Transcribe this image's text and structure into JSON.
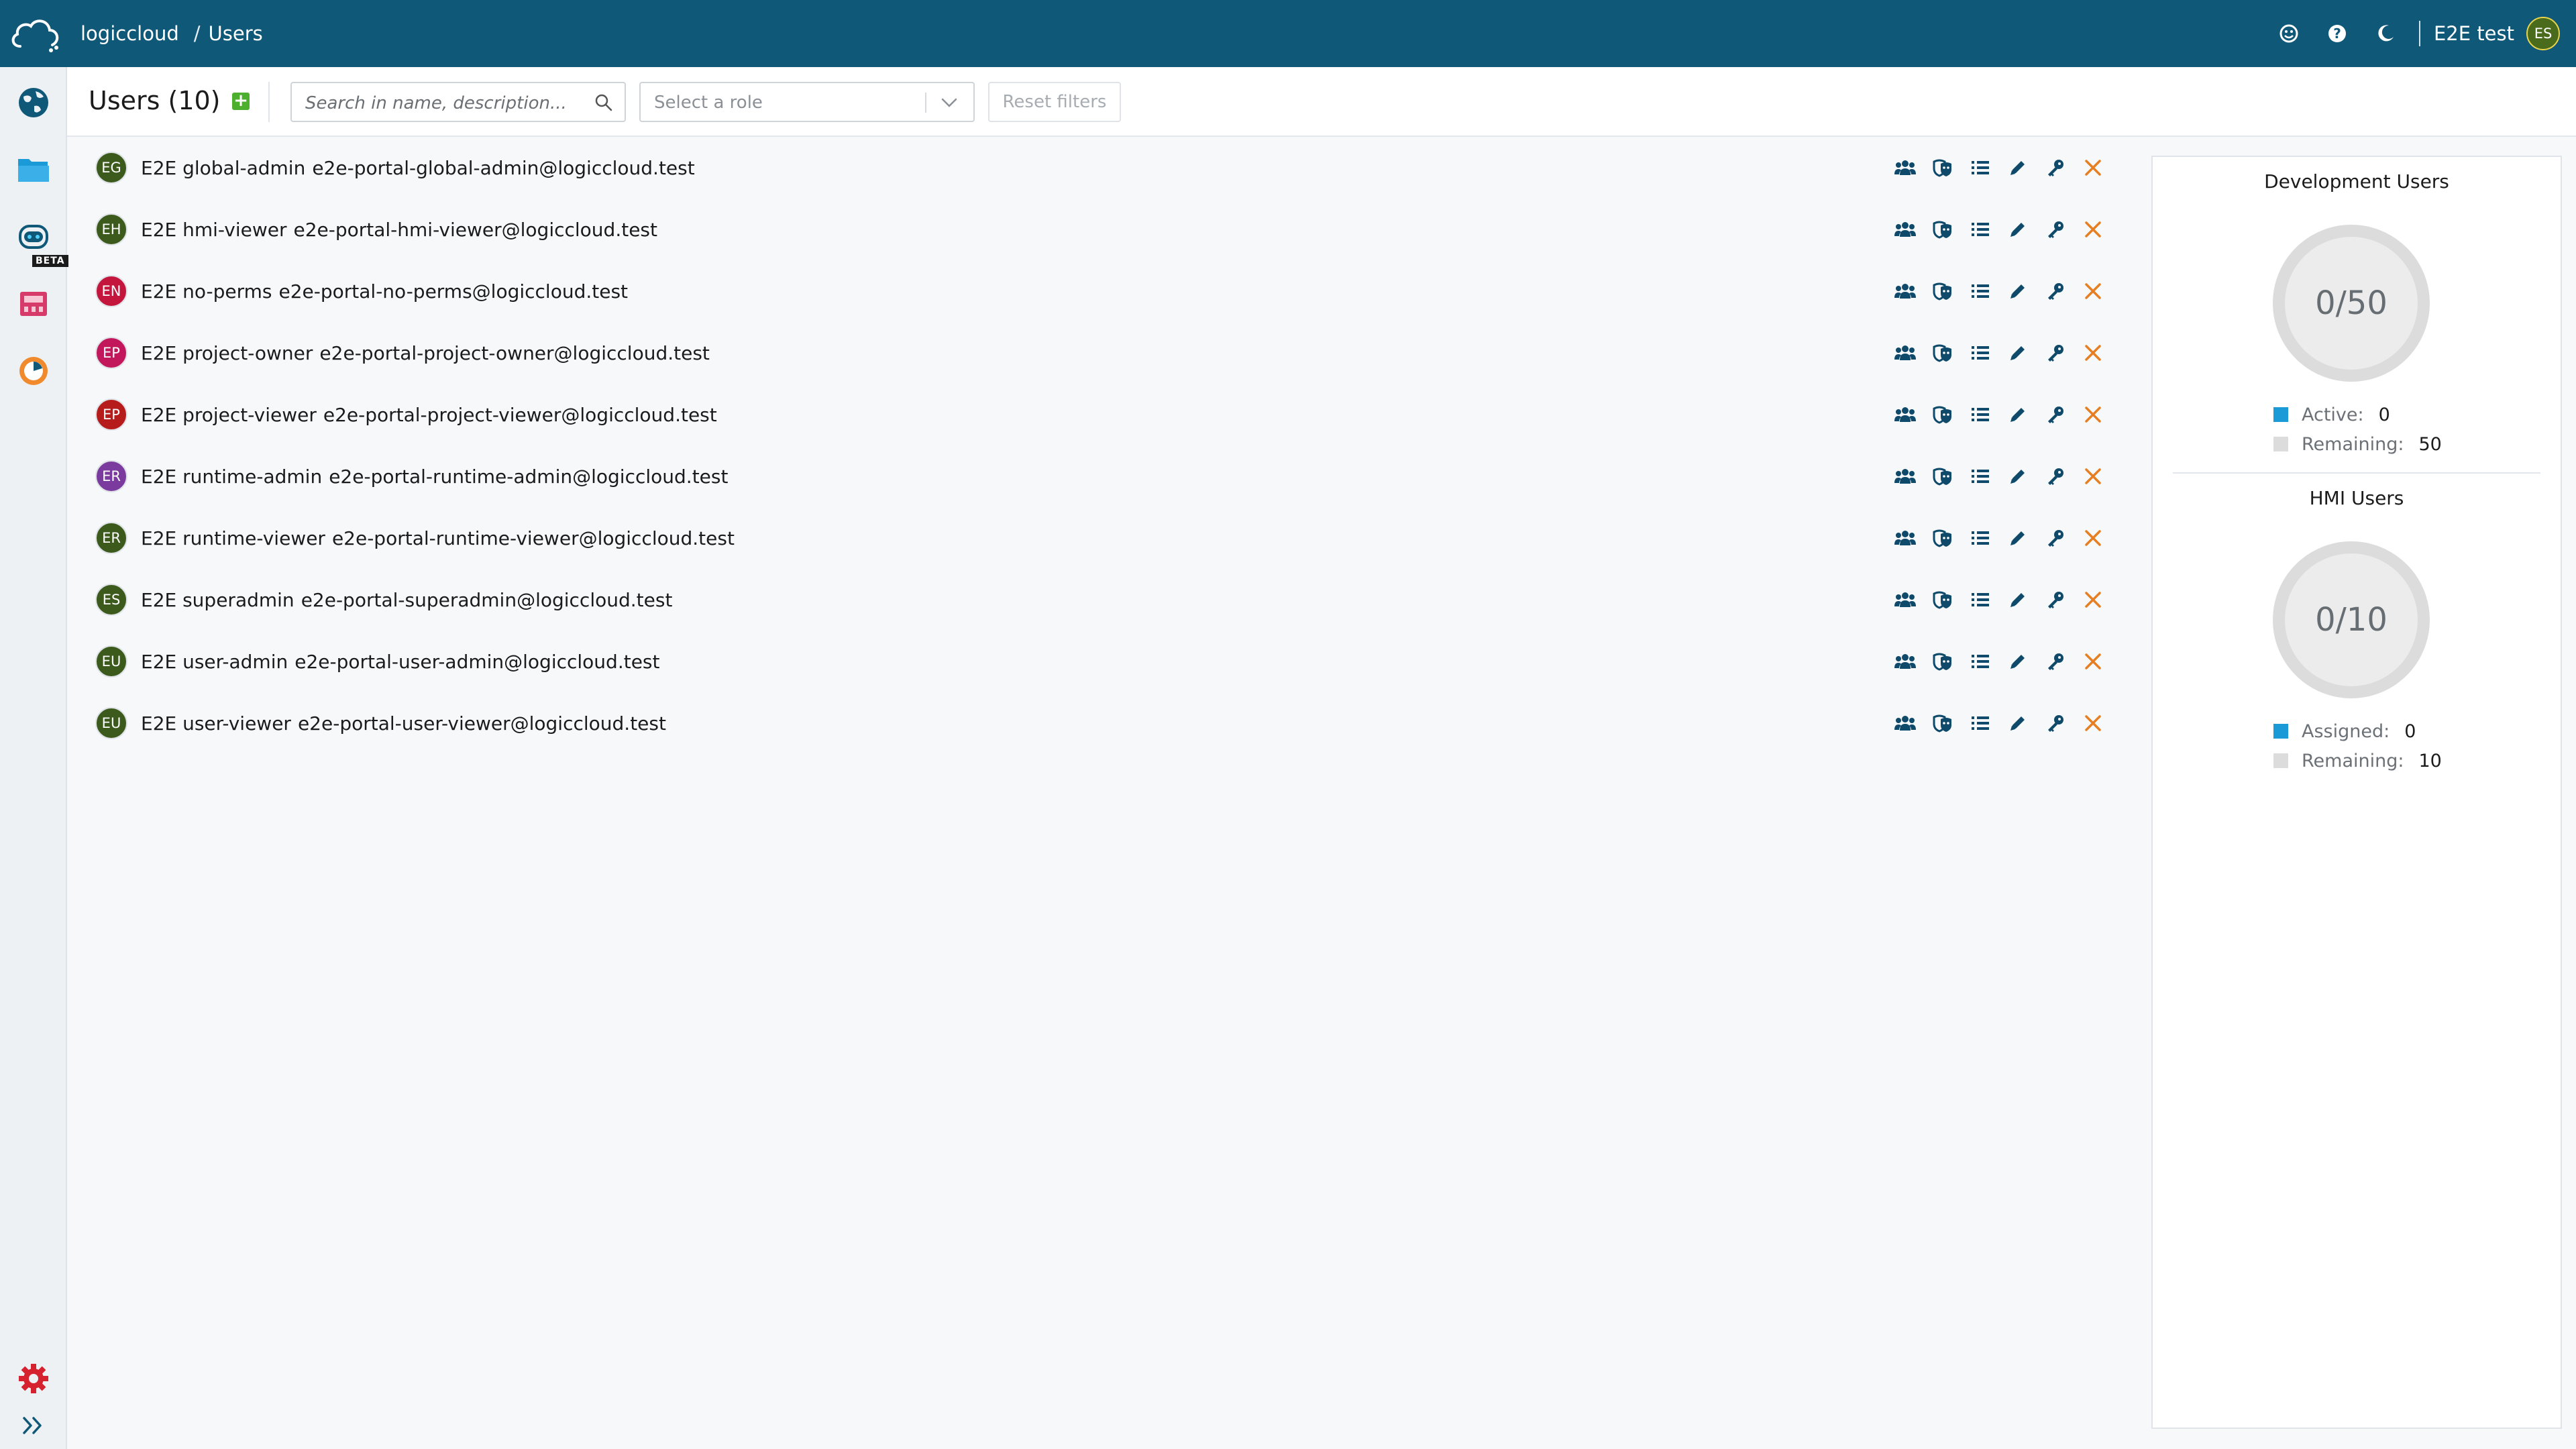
{
  "header": {
    "breadcrumbs": [
      "logiccloud",
      "/",
      "Users"
    ],
    "user_name": "E2E test",
    "user_initials": "ES",
    "icons": [
      "feedback-icon",
      "help-icon",
      "dark-mode-icon"
    ]
  },
  "sidebar": {
    "items": [
      {
        "name": "globe-icon"
      },
      {
        "name": "folder-icon"
      },
      {
        "name": "robot-icon",
        "badge": "BETA"
      },
      {
        "name": "plc-device-icon"
      },
      {
        "name": "monitoring-icon"
      }
    ],
    "bottom": [
      {
        "name": "settings-icon"
      },
      {
        "name": "expand-icon"
      }
    ]
  },
  "toolbar": {
    "title": "Users (10)",
    "add_label": "+",
    "search_placeholder": "Search in name, description...",
    "role_placeholder": "Select a role",
    "reset_label": "Reset filters"
  },
  "users": [
    {
      "initials": "EG",
      "name": "E2E global-admin",
      "email": "e2e-portal-global-admin@logiccloud.test",
      "color": "#3b5a1c"
    },
    {
      "initials": "EH",
      "name": "E2E hmi-viewer",
      "email": "e2e-portal-hmi-viewer@logiccloud.test",
      "color": "#3b5a1c"
    },
    {
      "initials": "EN",
      "name": "E2E no-perms",
      "email": "e2e-portal-no-perms@logiccloud.test",
      "color": "#c4163c"
    },
    {
      "initials": "EP",
      "name": "E2E project-owner",
      "email": "e2e-portal-project-owner@logiccloud.test",
      "color": "#c2185b"
    },
    {
      "initials": "EP",
      "name": "E2E project-viewer",
      "email": "e2e-portal-project-viewer@logiccloud.test",
      "color": "#b71c1c"
    },
    {
      "initials": "ER",
      "name": "E2E runtime-admin",
      "email": "e2e-portal-runtime-admin@logiccloud.test",
      "color": "#7b3a9e"
    },
    {
      "initials": "ER",
      "name": "E2E runtime-viewer",
      "email": "e2e-portal-runtime-viewer@logiccloud.test",
      "color": "#3b5a1c"
    },
    {
      "initials": "ES",
      "name": "E2E superadmin",
      "email": "e2e-portal-superadmin@logiccloud.test",
      "color": "#3b5a1c"
    },
    {
      "initials": "EU",
      "name": "E2E user-admin",
      "email": "e2e-portal-user-admin@logiccloud.test",
      "color": "#3b5a1c"
    },
    {
      "initials": "EU",
      "name": "E2E user-viewer",
      "email": "e2e-portal-user-viewer@logiccloud.test",
      "color": "#3b5a1c"
    }
  ],
  "row_actions": [
    "groups-icon",
    "roles-icon",
    "list-icon",
    "edit-icon",
    "key-icon",
    "remove-icon"
  ],
  "colors": {
    "header_bg": "#0f5878",
    "action_icon": "#0f4a6b",
    "remove_icon": "#e67e22",
    "active_legend": "#1a9ad6",
    "remaining_legend": "#dcdcdc"
  },
  "development_users": {
    "title": "Development Users",
    "gauge_text": "0/50",
    "used": 0,
    "total": 50,
    "legend": [
      {
        "label": "Active:",
        "value": "0"
      },
      {
        "label": "Remaining:",
        "value": "50"
      }
    ]
  },
  "hmi_users": {
    "title": "HMI Users",
    "gauge_text": "0/10",
    "used": 0,
    "total": 10,
    "legend": [
      {
        "label": "Assigned:",
        "value": "0"
      },
      {
        "label": "Remaining:",
        "value": "10"
      }
    ]
  }
}
